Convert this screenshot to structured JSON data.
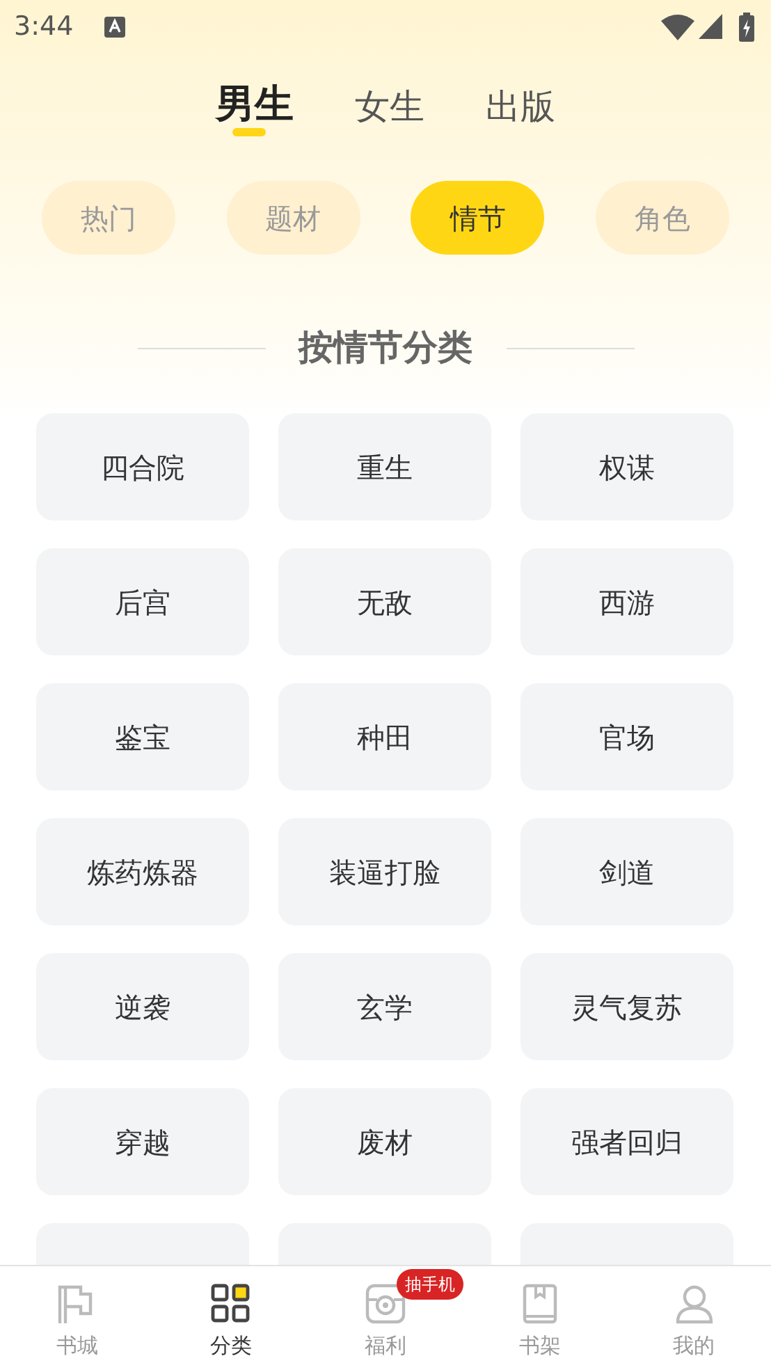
{
  "status_bar": {
    "time": "3:44"
  },
  "tabs": [
    {
      "label": "男生",
      "selected": true
    },
    {
      "label": "女生",
      "selected": false
    },
    {
      "label": "出版",
      "selected": false
    }
  ],
  "chips": [
    {
      "label": "热门",
      "selected": false
    },
    {
      "label": "题材",
      "selected": false
    },
    {
      "label": "情节",
      "selected": true
    },
    {
      "label": "角色",
      "selected": false
    }
  ],
  "section_title": "按情节分类",
  "categories": [
    {
      "kind": "tag",
      "label": "四合院"
    },
    {
      "kind": "tag",
      "label": "重生"
    },
    {
      "kind": "tag",
      "label": "权谋"
    },
    {
      "kind": "tag",
      "label": "后宫"
    },
    {
      "kind": "tag",
      "label": "无敌"
    },
    {
      "kind": "tag",
      "label": "西游"
    },
    {
      "kind": "tag",
      "label": "鉴宝"
    },
    {
      "kind": "tag",
      "label": "种田"
    },
    {
      "kind": "tag",
      "label": "官场"
    },
    {
      "kind": "tag",
      "label": "炼药炼器"
    },
    {
      "kind": "tag",
      "label": "装逼打脸"
    },
    {
      "kind": "tag",
      "label": "剑道"
    },
    {
      "kind": "tag",
      "label": "逆袭"
    },
    {
      "kind": "tag",
      "label": "玄学"
    },
    {
      "kind": "tag",
      "label": "灵气复苏"
    },
    {
      "kind": "tag",
      "label": "穿越"
    },
    {
      "kind": "tag",
      "label": "废材"
    },
    {
      "kind": "tag",
      "label": "强者回归"
    },
    {
      "kind": "blank"
    },
    {
      "kind": "blank"
    },
    {
      "kind": "blank"
    }
  ],
  "bottom_nav": [
    {
      "label": "书城",
      "selected": false
    },
    {
      "label": "分类",
      "selected": true
    },
    {
      "label": "福利",
      "selected": false,
      "badge": "抽手机"
    },
    {
      "label": "书架",
      "selected": false
    },
    {
      "label": "我的",
      "selected": false
    }
  ]
}
